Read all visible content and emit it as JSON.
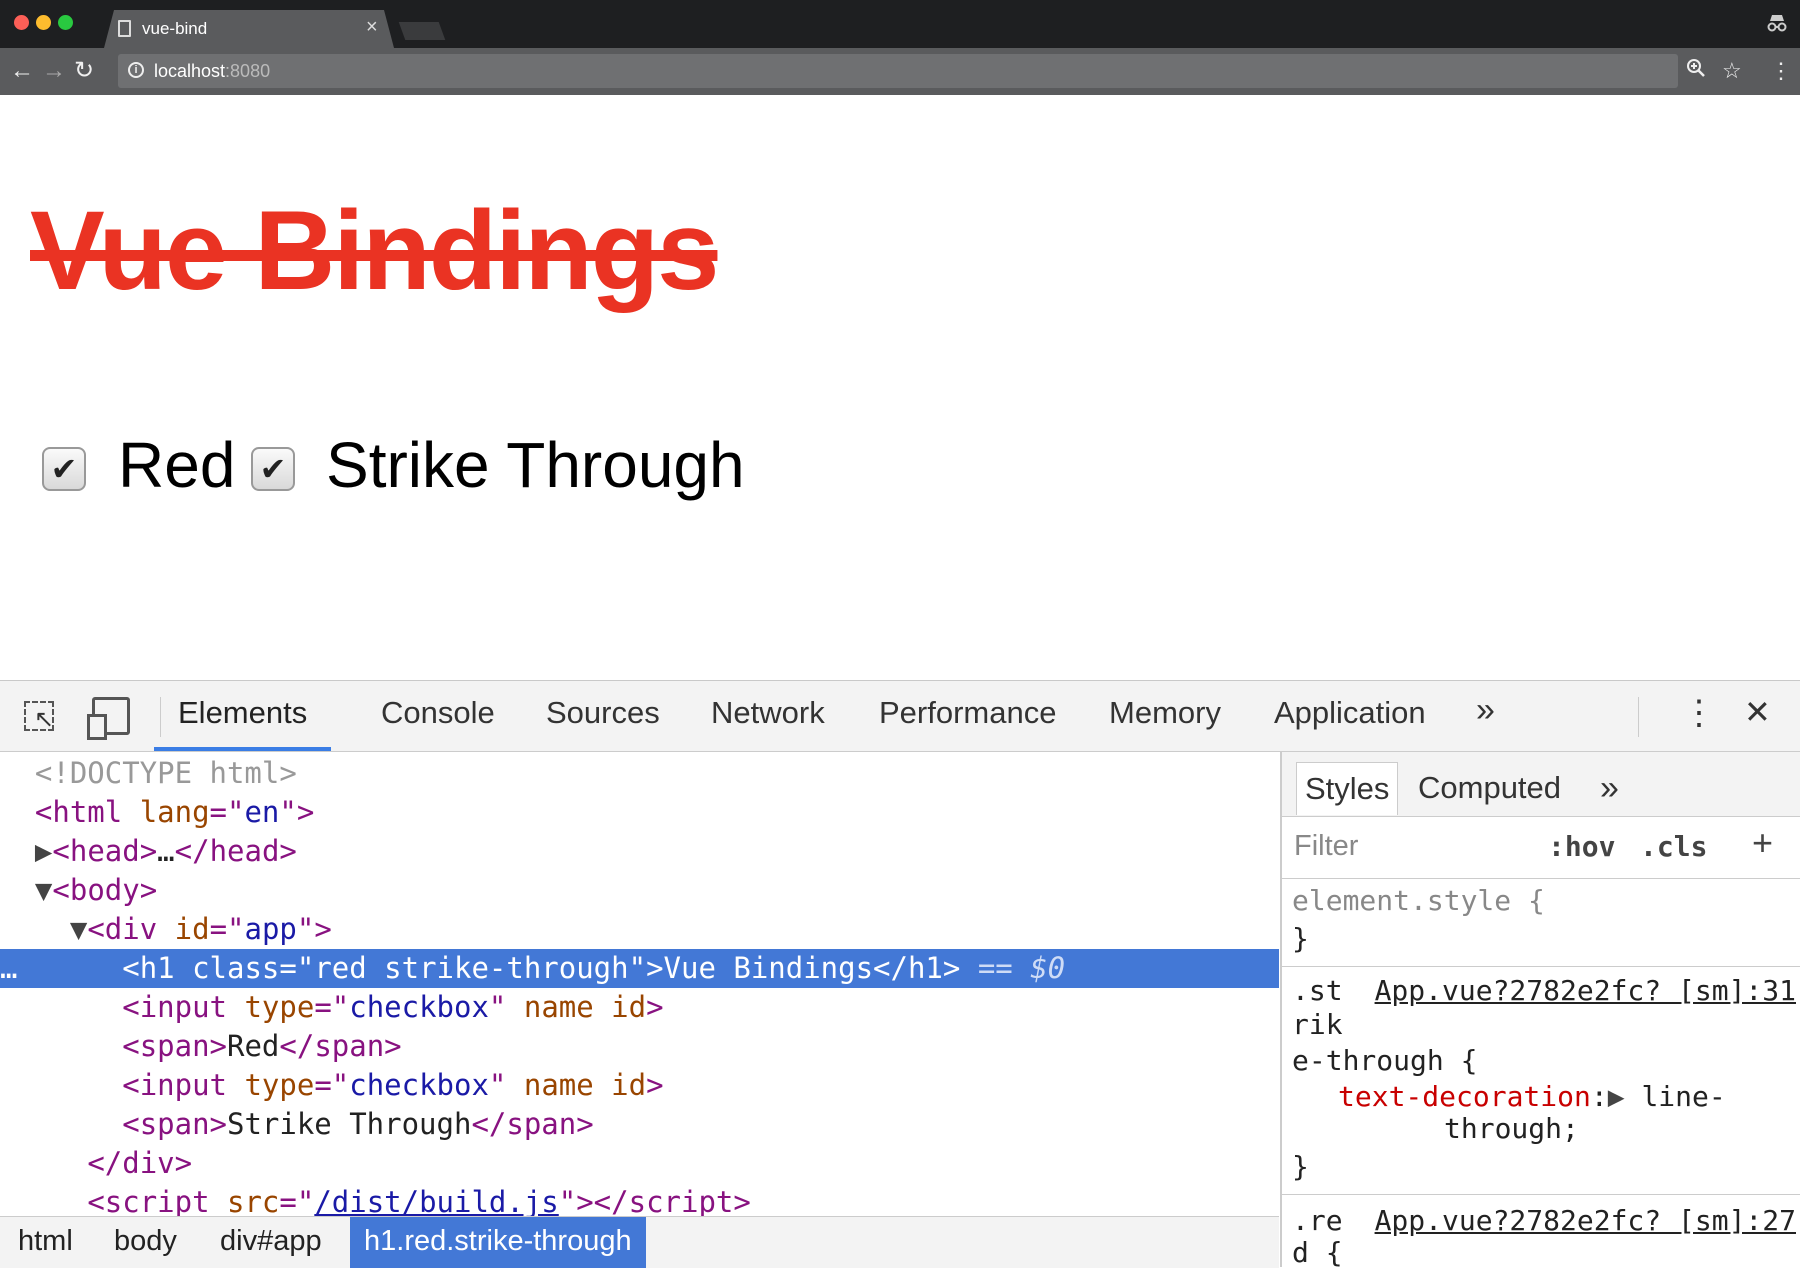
{
  "browser": {
    "tab_title": "vue-bind",
    "tab_close": "×",
    "url_host": "localhost",
    "url_port": ":8080",
    "icons": [
      "back-arrow-icon",
      "forward-arrow-icon",
      "reload-icon",
      "info-icon",
      "zoom-icon",
      "star-icon",
      "menu-dots-icon",
      "incognito-icon"
    ]
  },
  "page": {
    "heading": "Vue Bindings",
    "heading_color": "#ea3323",
    "checkbox_red_label": "Red",
    "checkbox_strike_label": "Strike Through",
    "checkbox_red_checked": true,
    "checkbox_strike_checked": true
  },
  "devtools": {
    "tabs": [
      "Elements",
      "Console",
      "Sources",
      "Network",
      "Performance",
      "Memory",
      "Application"
    ],
    "active_tab": "Elements",
    "more": "»",
    "close": "✕",
    "elements": {
      "doctype": "<!DOCTYPE html>",
      "html_tag": "html",
      "html_attr": "lang",
      "html_val": "en",
      "head_text": "head",
      "head_ellipsis": "…",
      "body_tag": "body",
      "div_tag": "div",
      "div_attr": "id",
      "div_val": "app",
      "h1_tag": "h1",
      "h1_attr": "class",
      "h1_val": "red strike-through",
      "h1_text": "Vue Bindings",
      "h1_marker": "== $0",
      "row_dots": "…",
      "input_tag": "input",
      "input_attr_type": "type",
      "input_val": "checkbox",
      "input_attr_name": "name",
      "input_attr_id": "id",
      "span_tag": "span",
      "span1_text": "Red",
      "span2_text": "Strike Through",
      "script_tag": "script",
      "script_attr": "src",
      "script_val": "/dist/build.js"
    },
    "breadcrumbs": [
      "html",
      "body",
      "div#app",
      "h1.red.strike-through"
    ],
    "styles": {
      "tabs": [
        "Styles",
        "Computed"
      ],
      "filter_placeholder": "Filter",
      "hov": ":hov",
      "cls": ".cls",
      "plus": "+",
      "element_style": "element.style {",
      "close_brace": "}",
      "rule1_selector_a": ".st",
      "rule1_selector_b": "rik",
      "rule1_selector_c": "e-through {",
      "rule1_source": "App.vue?2782e2fc? [sm]:31",
      "rule1_prop": "text-decoration",
      "rule1_value_a": "line-",
      "rule1_value_b": "through;",
      "rule2_selector_a": ".re",
      "rule2_selector_b": "d {",
      "rule2_source": "App.vue?2782e2fc? [sm]:27"
    }
  }
}
